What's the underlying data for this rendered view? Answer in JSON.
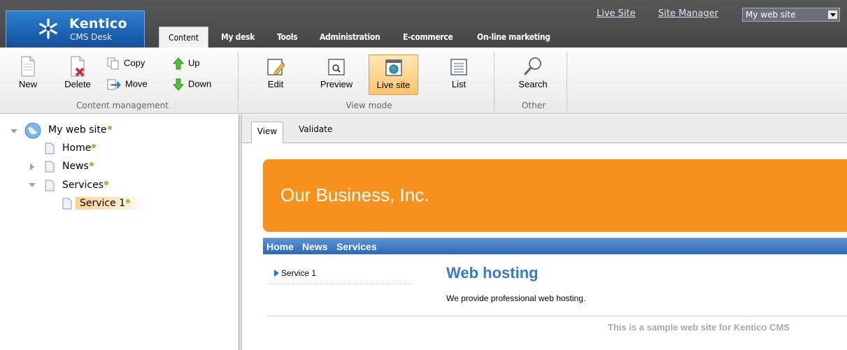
{
  "header": {
    "brand": "Kentico",
    "product": "CMS Desk",
    "links": [
      "Live Site",
      "Site Manager"
    ],
    "site_selector": "My web site",
    "tabs": [
      "Content",
      "My desk",
      "Tools",
      "Administration",
      "E-commerce",
      "On-line marketing"
    ],
    "active_tab": "Content"
  },
  "ribbon": {
    "content_management": {
      "label": "Content management",
      "new": "New",
      "delete": "Delete",
      "copy": "Copy",
      "move": "Move",
      "up": "Up",
      "down": "Down"
    },
    "view_mode": {
      "label": "View mode",
      "edit": "Edit",
      "preview": "Preview",
      "live_site": "Live site",
      "list": "List",
      "active": "Live site"
    },
    "other": {
      "label": "Other",
      "search": "Search"
    }
  },
  "tree": {
    "root": "My web site",
    "items": [
      "Home",
      "News",
      "Services",
      "Service 1"
    ],
    "selected": "Service 1"
  },
  "subtabs": [
    "View",
    "Validate"
  ],
  "preview": {
    "banner_title": "Our Business, Inc.",
    "menu": [
      "Home",
      "News",
      "Services"
    ],
    "side_item": "Service 1",
    "content_title": "Web hosting",
    "content_text": "We provide professional web hosting.",
    "footer": "This is a sample web site for Kentico CMS"
  },
  "colors": {
    "banner": "#f7921e",
    "menubar": "#2c69b9",
    "title": "#3a78c9",
    "status_dot": "#7fcf3e"
  }
}
